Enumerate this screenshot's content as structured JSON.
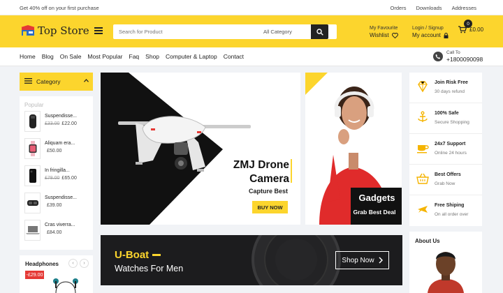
{
  "topbar": {
    "promo": "Get 40% off on your first purchase",
    "links": [
      "Orders",
      "Downloads",
      "Addresses"
    ]
  },
  "header": {
    "logo": "Top Store",
    "search": {
      "placeholder": "Search for Product",
      "category": "All Category"
    },
    "favourite": {
      "label": "My Favourite",
      "title": "Wishlist"
    },
    "account": {
      "label": "Login / Signup",
      "title": "My account"
    },
    "cart": {
      "count": "0",
      "total": "£0.00"
    }
  },
  "nav": {
    "items": [
      "Home",
      "Blog",
      "On Sale",
      "Most Popular",
      "Faq",
      "Shop",
      "Computer & Laptop",
      "Contact"
    ],
    "call_label": "Call To",
    "call_number": "+1800090098"
  },
  "sidebar": {
    "category_label": "Category",
    "popular_title": "Popular",
    "products": [
      {
        "name": "Suspendisse...",
        "old_price": "£33.00",
        "price": "£22.00"
      },
      {
        "name": "Aliquam era...",
        "old_price": "",
        "price": "£50.00"
      },
      {
        "name": "In fringilla...",
        "old_price": "£78.00",
        "price": "£65.00"
      },
      {
        "name": "Suspendisse...",
        "old_price": "",
        "price": "£39.00"
      },
      {
        "name": "Cras viverra...",
        "old_price": "",
        "price": "£84.00"
      }
    ],
    "headphones_title": "Headphones",
    "headphones_sale": "-£29.00"
  },
  "banners": {
    "drone": {
      "title_line1": "ZMJ Drone",
      "title_line2": "Camera",
      "subtitle": "Capture Best",
      "button": "BUY NOW"
    },
    "gadgets": {
      "title": "Gadgets",
      "subtitle": "Grab Best Deal"
    },
    "uboat": {
      "title": "U-Boat",
      "subtitle": "Watches For Men",
      "button": "Shop Now"
    }
  },
  "features": [
    {
      "title": "Join Risk Free",
      "subtitle": "30 days refund",
      "icon": "diamond-icon"
    },
    {
      "title": "100% Safe",
      "subtitle": "Secure Shopping",
      "icon": "anchor-icon"
    },
    {
      "title": "24x7 Support",
      "subtitle": "Online 24 hours",
      "icon": "cup-icon"
    },
    {
      "title": "Best Offers",
      "subtitle": "Grab Now",
      "icon": "basket-icon"
    },
    {
      "title": "Free Shiping",
      "subtitle": "On all order over",
      "icon": "plane-icon"
    }
  ],
  "about": {
    "title": "About Us"
  },
  "colors": {
    "accent": "#fcd52d",
    "dark": "#1c1c1e",
    "sale": "#e53935"
  }
}
